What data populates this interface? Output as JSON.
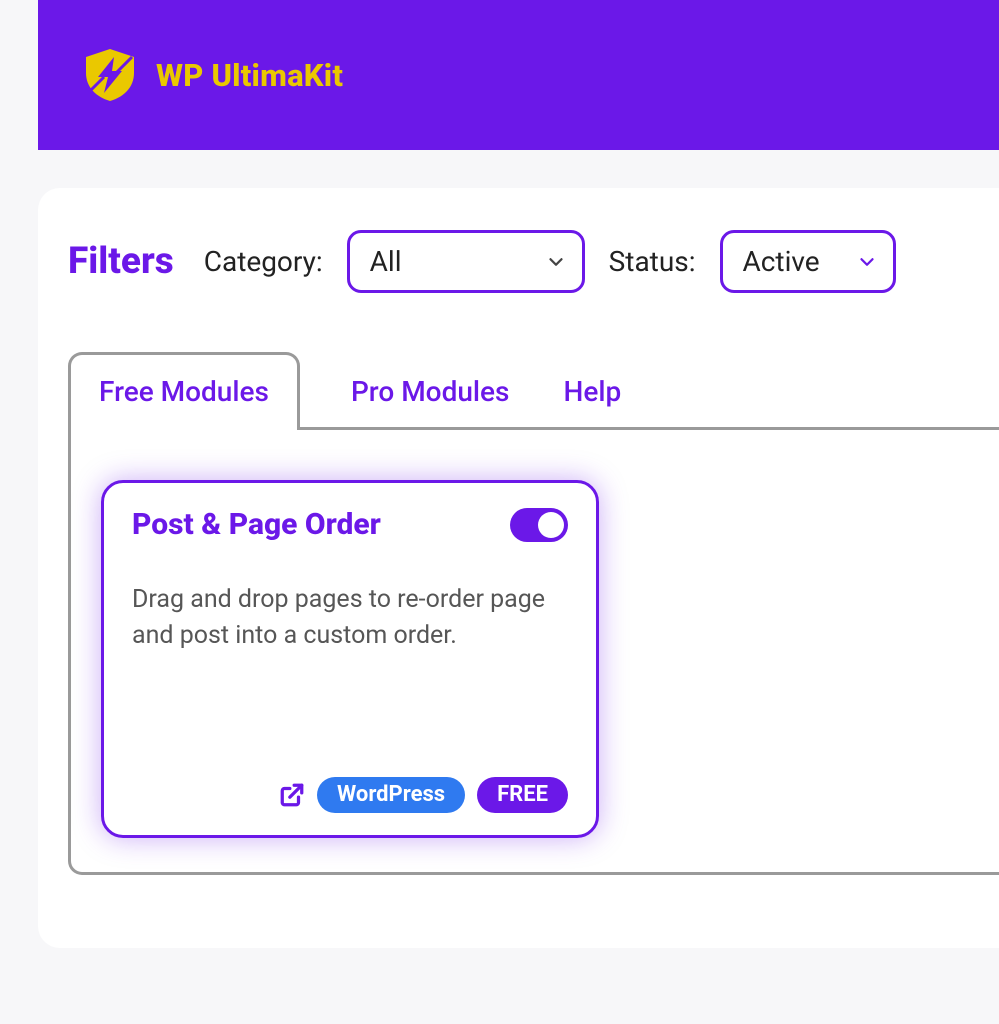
{
  "header": {
    "brand": "WP UltimaKit"
  },
  "filters": {
    "title": "Filters",
    "category_label": "Category:",
    "category_value": "All",
    "status_label": "Status:",
    "status_value": "Active"
  },
  "tabs": [
    {
      "label": "Free Modules",
      "active": true
    },
    {
      "label": "Pro Modules",
      "active": false
    },
    {
      "label": "Help",
      "active": false
    }
  ],
  "module": {
    "title": "Post & Page Order",
    "enabled": true,
    "description": "Drag and drop pages to re-order page and post into a custom order.",
    "badge_category": "WordPress",
    "badge_tier": "FREE"
  }
}
